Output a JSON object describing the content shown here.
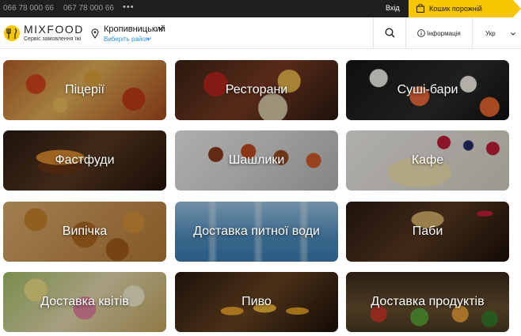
{
  "topbar": {
    "phone_1": "066 78 000 66",
    "phone_2": "067 78 000 66",
    "more": "•••",
    "login_label": "Вхід",
    "cart_label": "Кошик порожній"
  },
  "header": {
    "logo_text": "MIXFOOD",
    "logo_sub": "Сервіс замовлення їжі",
    "city": "Кропивницький",
    "district_link": "Виберіть район",
    "info_label": "Інформація",
    "lang_label": "Укр"
  },
  "colors": {
    "accent": "#f7c600",
    "link": "#2e8fd6",
    "topbar_bg": "#1f1f1f"
  },
  "categories": [
    {
      "label": "Піцерії",
      "image": "pizza"
    },
    {
      "label": "Ресторани",
      "image": "restaurant"
    },
    {
      "label": "Суші-бари",
      "image": "sushi"
    },
    {
      "label": "Фастфуди",
      "image": "burger"
    },
    {
      "label": "Шашлики",
      "image": "kebab"
    },
    {
      "label": "Кафе",
      "image": "cake"
    },
    {
      "label": "Випічка",
      "image": "bakery"
    },
    {
      "label": "Доставка питної води",
      "image": "water"
    },
    {
      "label": "Паби",
      "image": "pub"
    },
    {
      "label": "Доставка квітів",
      "image": "flowers"
    },
    {
      "label": "Пиво",
      "image": "beer"
    },
    {
      "label": "Доставка продуктів",
      "image": "groceries"
    }
  ]
}
